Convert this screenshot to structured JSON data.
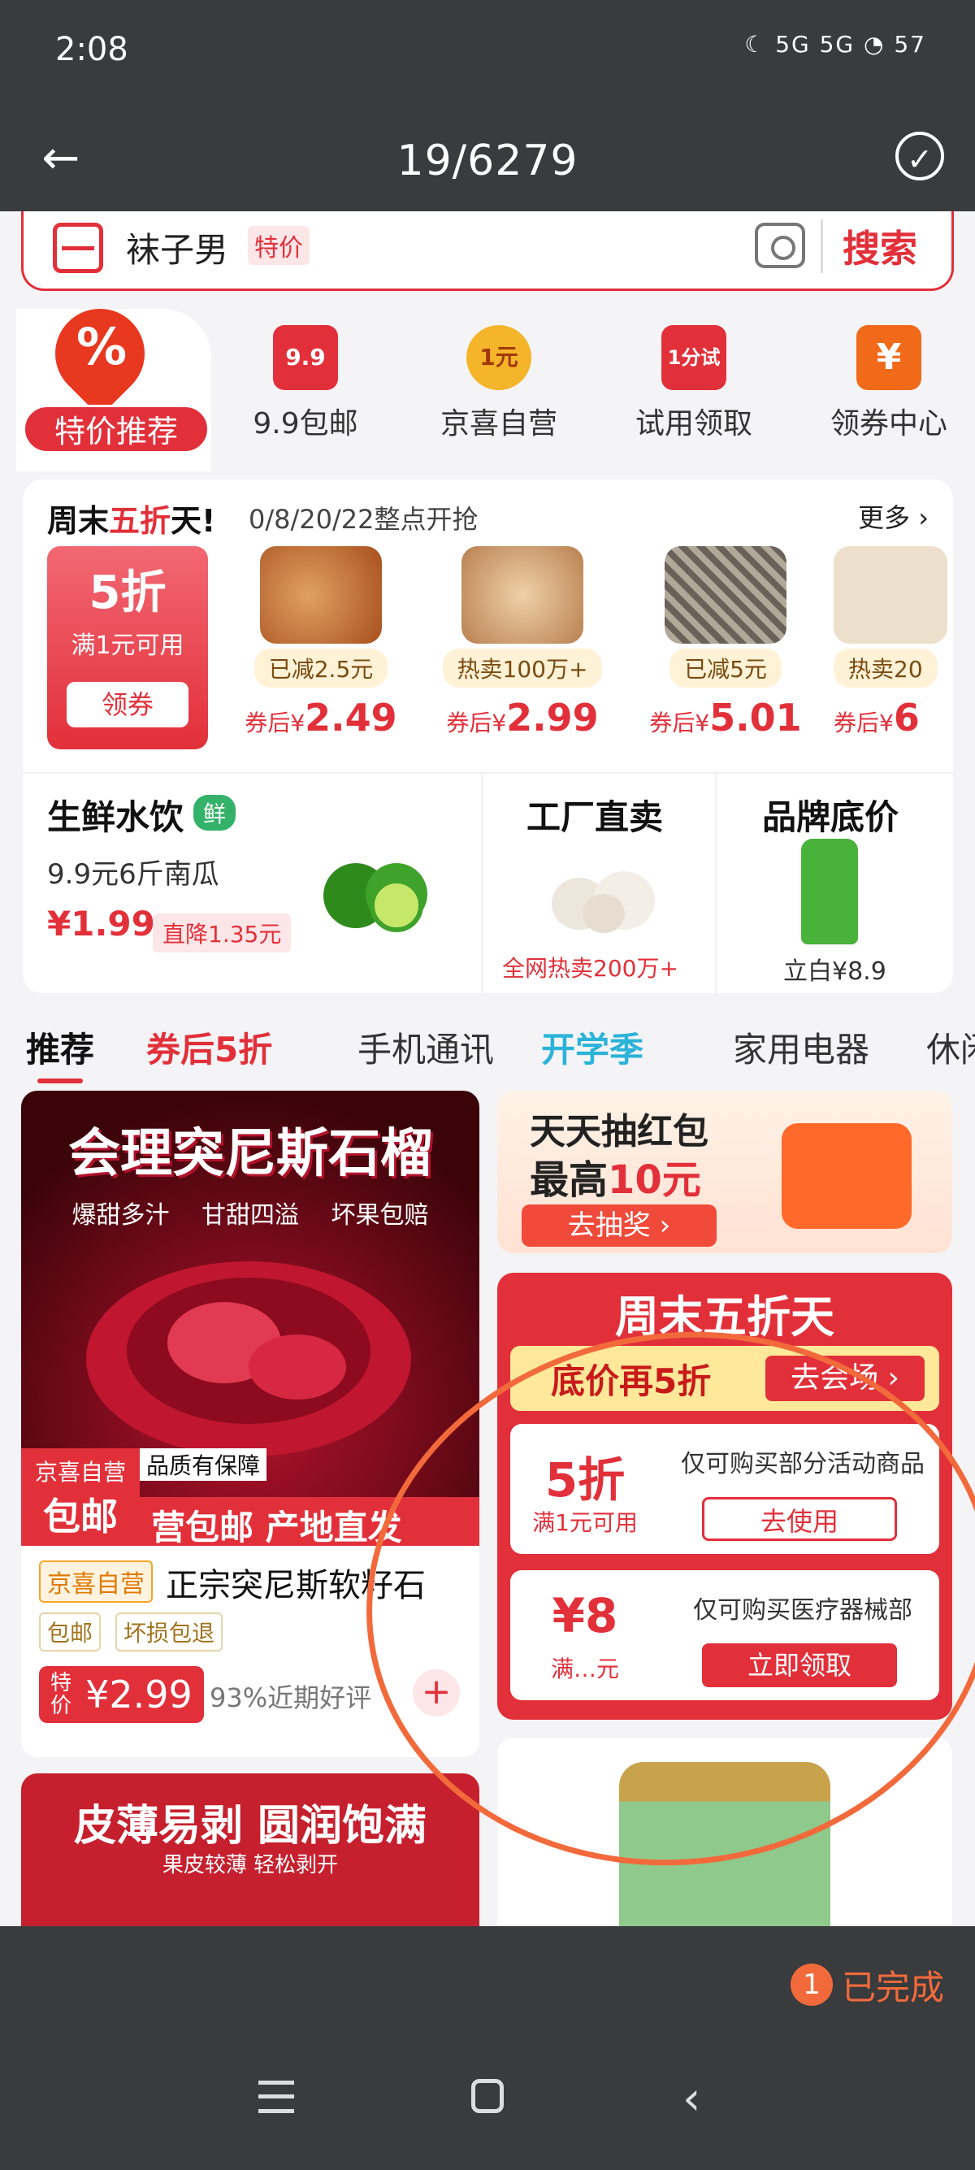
{
  "status": {
    "time": "2:08",
    "icons_text": "☾ 5G 5G ◔ 57",
    "battery": "57"
  },
  "titlebar": {
    "title": "19/6279"
  },
  "search": {
    "query": "袜子男",
    "tag": "特价",
    "button": "搜索"
  },
  "categories": [
    {
      "label": "特价推荐",
      "icon": "flame-percent-icon",
      "color": "#e8381f"
    },
    {
      "label": "9.9包邮",
      "icon_text": "9.9",
      "color": "#e2303a"
    },
    {
      "label": "京喜自营",
      "icon_text": "1元",
      "color": "#f5b52a"
    },
    {
      "label": "试用领取",
      "icon_text": "1分试",
      "color": "#e2303a"
    },
    {
      "label": "领券中心",
      "icon_text": "¥",
      "color": "#f06a1a"
    }
  ],
  "weekend": {
    "title_a": "周末",
    "title_b": "五折",
    "title_c": "天!",
    "time": "0/8/20/22整点开抢",
    "more": "更多 ›",
    "coupon": {
      "big": "5折",
      "sub": "满1元可用",
      "button": "领券"
    },
    "products": [
      {
        "tag": "已减2.5元",
        "price_prefix": "券后¥",
        "price": "2.49",
        "color": "#c8763a"
      },
      {
        "tag": "热卖100万+",
        "price_prefix": "券后¥",
        "price": "2.99",
        "color": "#d8a878"
      },
      {
        "tag": "已减5元",
        "price_prefix": "券后¥",
        "price": "5.01",
        "color": "#8a8070"
      },
      {
        "tag": "热卖20",
        "price_prefix": "券后¥",
        "price": "6",
        "color": "#e8dcc8"
      }
    ]
  },
  "sections": {
    "fresh": {
      "title": "生鲜水饮",
      "tag": "鲜",
      "desc": "9.9元6斤南瓜",
      "price": "¥1.99",
      "cut": "直降1.35元"
    },
    "factory": {
      "title": "工厂直卖",
      "sub": "全网热卖200万+"
    },
    "brand": {
      "title": "品牌底价",
      "sub": "立白¥8.9"
    }
  },
  "tabs": [
    "推荐",
    "券后5折",
    "手机通讯",
    "开学季",
    "家用电器",
    "休闲"
  ],
  "card_left": {
    "headline": "会理突尼斯石榴",
    "subline": "爆甜多汁 甘甜四溢 坏果包赔",
    "band": "营包邮 产地直发",
    "badge_top": "京喜自营",
    "badge_bottom": "包邮",
    "quality": "品质有保障",
    "shop_tag": "京喜自营",
    "name": "正宗突尼斯软籽石",
    "tag1": "包邮",
    "tag2": "坏损包退",
    "price_label": "特价",
    "price": "¥2.99",
    "rating": "93%近期好评",
    "add": "+"
  },
  "card_left2": {
    "headline": "皮薄易剥 圆润饱满",
    "sub": "果皮较薄 轻松剥开"
  },
  "card_redpack": {
    "line1": "天天抽红包",
    "line2a": "最高",
    "line2b": "10元",
    "button": "去抽奖 ›"
  },
  "card_weekend": {
    "title": "周末五折天",
    "bar_text": "底价再5折",
    "bar_button": "去会场 ›",
    "coupons": [
      {
        "amount": "5折",
        "condition": "满1元可用",
        "desc": "仅可购买部分活动商品",
        "button": "去使用"
      },
      {
        "amount": "¥8",
        "condition": "满…元",
        "desc": "仅可购买医疗器械部",
        "button": "立即领取"
      }
    ]
  },
  "done": {
    "count": "1",
    "label": "已完成"
  },
  "colors": {
    "accent": "#e2303a",
    "annotation": "#f26a3c",
    "dark_bar": "#3a3b3d"
  }
}
